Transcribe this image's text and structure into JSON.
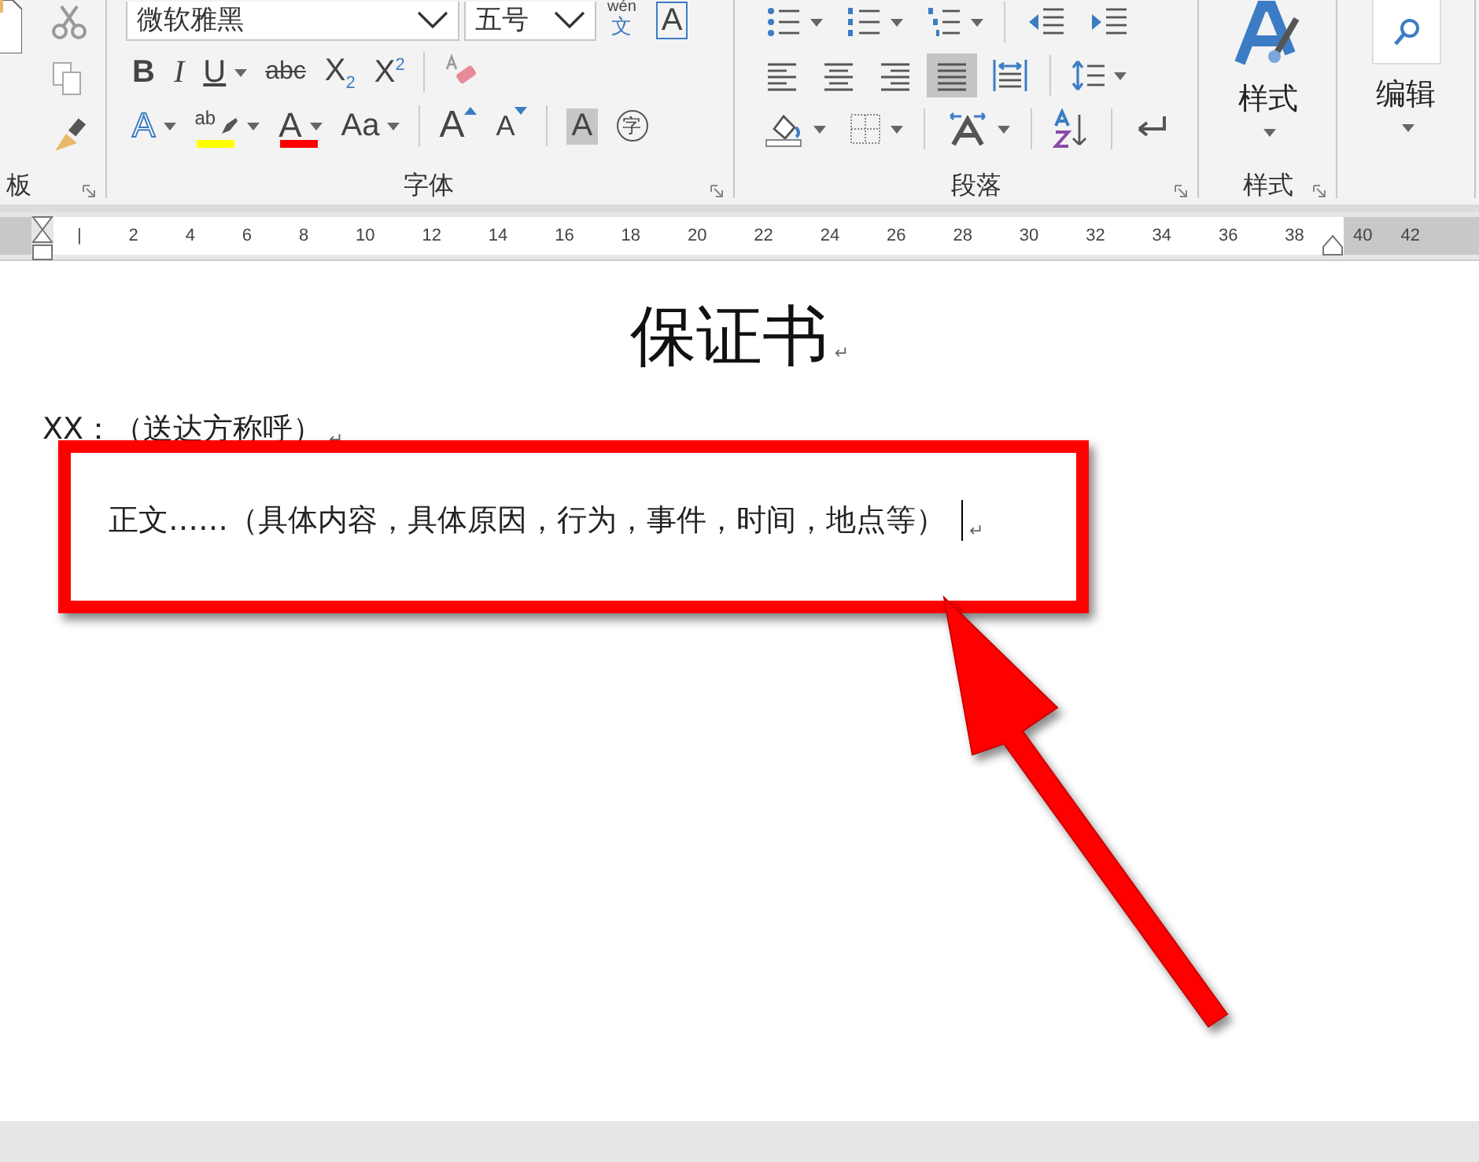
{
  "ribbon": {
    "clipboard": {
      "group_label": "板",
      "tools": [
        {
          "kind": "cut"
        },
        {
          "kind": "copy"
        },
        {
          "kind": "painter"
        }
      ]
    },
    "font": {
      "font_name": "微软雅黑",
      "font_size": "五号",
      "phonetic": {
        "top": "wén",
        "bottom": "文"
      },
      "border_label": "A",
      "group_label": "字体",
      "row2": [
        {
          "kind": "bold",
          "label": "B",
          "dropdown": false
        },
        {
          "kind": "italic",
          "label": "I",
          "dropdown": false
        },
        {
          "kind": "underline",
          "label": "U",
          "dropdown": true
        },
        {
          "kind": "strike",
          "label": "abc",
          "dropdown": false
        },
        {
          "kind": "plain",
          "label": "X$_{2}$",
          "dropdown": false
        },
        {
          "kind": "plain",
          "label": "X$^{2}$",
          "dropdown": false
        },
        {
          "kind": "sep"
        },
        {
          "kind": "eraser",
          "dropdown": false
        }
      ],
      "row3": [
        {
          "kind": "effect",
          "label": "A",
          "dropdown": true
        },
        {
          "kind": "highlight",
          "label": "ab",
          "color": "#ffff00",
          "dropdown": true
        },
        {
          "kind": "fontcolor",
          "label": "A",
          "color": "#ff0000",
          "dropdown": true
        },
        {
          "kind": "plain",
          "label": "Aa",
          "dropdown": true
        },
        {
          "kind": "sep"
        },
        {
          "kind": "grow",
          "label": "A",
          "dropdown": false
        },
        {
          "kind": "shrink",
          "label": "A",
          "dropdown": false
        },
        {
          "kind": "sep"
        },
        {
          "kind": "shaded",
          "label": "A",
          "dropdown": false
        },
        {
          "kind": "enclose",
          "label": "字",
          "dropdown": false
        }
      ]
    },
    "paragraph": {
      "group_label": "段落",
      "row1": [
        {
          "kind": "bullets",
          "dropdown": true,
          "selected": false
        },
        {
          "kind": "numbering",
          "dropdown": true,
          "selected": false
        },
        {
          "kind": "multilevel",
          "dropdown": true,
          "selected": false
        },
        {
          "kind": "sep"
        },
        {
          "kind": "outdent",
          "dropdown": false,
          "selected": false
        },
        {
          "kind": "indent",
          "dropdown": false,
          "selected": false
        }
      ],
      "row2": [
        {
          "kind": "align-left",
          "dropdown": false,
          "selected": false
        },
        {
          "kind": "align-center",
          "dropdown": false,
          "selected": false
        },
        {
          "kind": "align-right",
          "dropdown": false,
          "selected": false
        },
        {
          "kind": "justify",
          "dropdown": false,
          "selected": true
        },
        {
          "kind": "distribute",
          "dropdown": false,
          "selected": false
        },
        {
          "kind": "sep"
        },
        {
          "kind": "spacing",
          "dropdown": true,
          "selected": false
        }
      ],
      "row3": [
        {
          "kind": "fill",
          "dropdown": true,
          "selected": false
        },
        {
          "kind": "borders",
          "dropdown": true,
          "selected": false
        },
        {
          "kind": "sep"
        },
        {
          "kind": "direction",
          "dropdown": true,
          "selected": false
        },
        {
          "kind": "sep"
        },
        {
          "kind": "sort",
          "dropdown": false,
          "selected": false
        },
        {
          "kind": "sep"
        },
        {
          "kind": "marks",
          "dropdown": false,
          "selected": false
        }
      ]
    },
    "styles": {
      "button_label": "样式",
      "group_label": "样式"
    },
    "editing": {
      "button_label": "编辑"
    }
  },
  "ruler": {
    "labels": [
      "|",
      "2",
      "4",
      "6",
      "8",
      "10",
      "12",
      "14",
      "16",
      "18",
      "20",
      "22",
      "24",
      "26",
      "28",
      "30",
      "32",
      "34",
      "36",
      "38",
      "40",
      "42"
    ]
  },
  "document": {
    "title": "保证书",
    "mark": "↵",
    "paragraphs": [
      {
        "text": "XX：（送达方称呼）",
        "highlighted": false
      },
      {
        "text": "正文……（具体内容，具体原因，行为，事件，时间，地点等）",
        "highlighted": true,
        "cursor": true
      }
    ]
  }
}
